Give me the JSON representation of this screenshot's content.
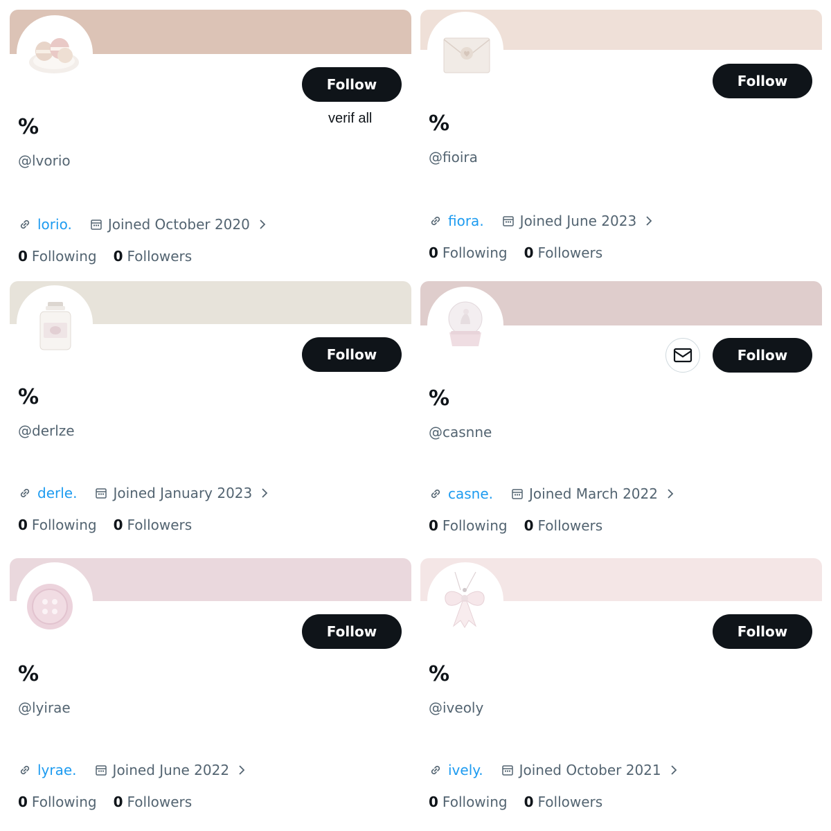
{
  "cards": [
    {
      "banner_color": "#dcc3b6",
      "avatar_icon": "macaron-icon",
      "display_name": "%",
      "handle": "@lvorio",
      "link": "lorio.",
      "joined": "Joined October 2020",
      "follow_label": "Follow",
      "note": "verif all",
      "following_count": "0",
      "following_label": "Following",
      "followers_count": "0",
      "followers_label": "Followers"
    },
    {
      "banner_color": "#efe0d8",
      "avatar_icon": "envelope-seal-icon",
      "display_name": "%",
      "handle": "@fioira",
      "link": "fiora.",
      "joined": "Joined June 2023",
      "follow_label": "Follow",
      "following_count": "0",
      "following_label": "Following",
      "followers_count": "0",
      "followers_label": "Followers"
    },
    {
      "banner_color": "#e7e3da",
      "avatar_icon": "candle-jar-icon",
      "display_name": "%",
      "handle": "@derlze",
      "link": "derle.",
      "joined": "Joined January 2023",
      "follow_label": "Follow",
      "following_count": "0",
      "following_label": "Following",
      "followers_count": "0",
      "followers_label": "Followers"
    },
    {
      "banner_color": "#dfcdcc",
      "avatar_icon": "snow-globe-icon",
      "display_name": "%",
      "handle": "@casnne",
      "link": "casne.",
      "joined": "Joined March 2022",
      "follow_label": "Follow",
      "message_icon": "mail-icon",
      "following_count": "0",
      "following_label": "Following",
      "followers_count": "0",
      "followers_label": "Followers"
    },
    {
      "banner_color": "#ead8dd",
      "avatar_icon": "button-icon",
      "display_name": "%",
      "handle": "@lyirae",
      "link": "lyrae.",
      "joined": "Joined June 2022",
      "follow_label": "Follow",
      "following_count": "0",
      "following_label": "Following",
      "followers_count": "0",
      "followers_label": "Followers"
    },
    {
      "banner_color": "#f4e6e6",
      "avatar_icon": "bow-icon",
      "display_name": "%",
      "handle": "@iveoly",
      "link": "ively.",
      "joined": "Joined October 2021",
      "follow_label": "Follow",
      "following_count": "0",
      "following_label": "Following",
      "followers_count": "0",
      "followers_label": "Followers"
    }
  ],
  "colors": {
    "text_primary": "#0f1419",
    "text_secondary": "#536471",
    "link": "#1d9bf0",
    "button_bg": "#0f1419"
  }
}
